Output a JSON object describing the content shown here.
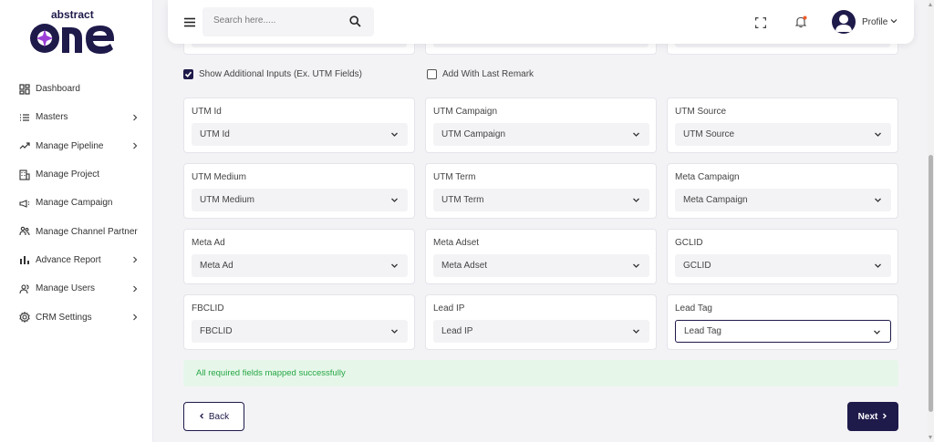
{
  "logo": {
    "top_text": "abstract",
    "bottom_text": "one"
  },
  "sidebar": {
    "items": [
      {
        "label": "Dashboard",
        "icon": "dashboard-icon",
        "has_chevron": false
      },
      {
        "label": "Masters",
        "icon": "list-icon",
        "has_chevron": true
      },
      {
        "label": "Manage Pipeline",
        "icon": "pipeline-icon",
        "has_chevron": true
      },
      {
        "label": "Manage Project",
        "icon": "building-icon",
        "has_chevron": false
      },
      {
        "label": "Manage Campaign",
        "icon": "megaphone-icon",
        "has_chevron": false
      },
      {
        "label": "Manage Channel Partner",
        "icon": "handshake-icon",
        "has_chevron": false
      },
      {
        "label": "Advance Report",
        "icon": "bar-chart-icon",
        "has_chevron": true
      },
      {
        "label": "Manage Users",
        "icon": "users-icon",
        "has_chevron": true
      },
      {
        "label": "CRM Settings",
        "icon": "gear-icon",
        "has_chevron": true
      }
    ]
  },
  "header": {
    "search_placeholder": "Search here.....",
    "profile_label": "Profile"
  },
  "options": {
    "show_additional_inputs": {
      "label": "Show Additional Inputs (Ex. UTM Fields)",
      "checked": true
    },
    "add_with_last_remark": {
      "label": "Add With Last Remark",
      "checked": false
    }
  },
  "fields": [
    {
      "label": "UTM Id",
      "value": "UTM Id"
    },
    {
      "label": "UTM Campaign",
      "value": "UTM Campaign"
    },
    {
      "label": "UTM Source",
      "value": "UTM Source"
    },
    {
      "label": "UTM Medium",
      "value": "UTM Medium"
    },
    {
      "label": "UTM Term",
      "value": "UTM Term"
    },
    {
      "label": "Meta Campaign",
      "value": "Meta Campaign"
    },
    {
      "label": "Meta Ad",
      "value": "Meta Ad"
    },
    {
      "label": "Meta Adset",
      "value": "Meta Adset"
    },
    {
      "label": "GCLID",
      "value": "GCLID"
    },
    {
      "label": "FBCLID",
      "value": "FBCLID"
    },
    {
      "label": "Lead IP",
      "value": "Lead IP"
    },
    {
      "label": "Lead Tag",
      "value": "Lead Tag",
      "focused": true
    }
  ],
  "status": {
    "message": "All required fields mapped successfully"
  },
  "actions": {
    "back_label": "Back",
    "next_label": "Next"
  },
  "colors": {
    "brand": "#1e1a4a",
    "success_bg": "#e6f7ea",
    "success_text": "#27a644"
  }
}
